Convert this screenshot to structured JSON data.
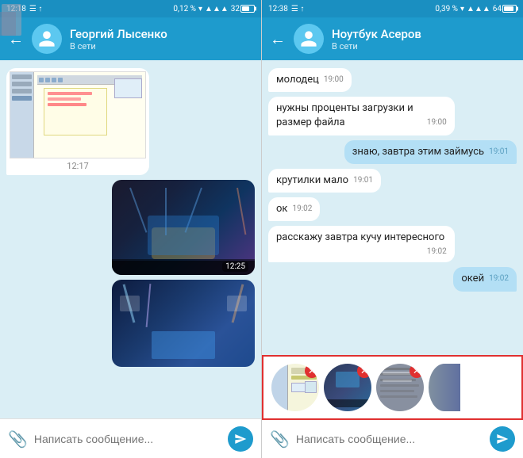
{
  "left": {
    "statusBar": {
      "time": "12:18",
      "icons": "☰ ↑",
      "percent": "0,12 %",
      "battery": "32",
      "signal": "▲▲▲"
    },
    "header": {
      "backLabel": "←",
      "name": "Георгий Лысенко",
      "status": "В сети"
    },
    "messages": [
      {
        "type": "screenshot",
        "time": "12:17",
        "direction": "incoming"
      },
      {
        "type": "concert1",
        "time": "12:25",
        "direction": "outgoing"
      },
      {
        "type": "concert2",
        "direction": "outgoing"
      }
    ],
    "input": {
      "placeholder": "Написать сообщение...",
      "attachIcon": "📎"
    }
  },
  "right": {
    "statusBar": {
      "time": "12:38",
      "percent": "0,39 %",
      "battery": "64"
    },
    "header": {
      "backLabel": "←",
      "name": "Ноутбук Асеров",
      "status": "В сети"
    },
    "messages": [
      {
        "type": "text",
        "text": "молодец",
        "time": "19:00",
        "direction": "incoming"
      },
      {
        "type": "text",
        "text": "нужны проценты загрузки и размер файла",
        "time": "19:00",
        "direction": "incoming"
      },
      {
        "type": "text",
        "text": "знаю, завтра этим займусь",
        "time": "19:01",
        "direction": "outgoing"
      },
      {
        "type": "text",
        "text": "крутилки мало",
        "time": "19:01",
        "direction": "incoming"
      },
      {
        "type": "text",
        "text": "ок",
        "time": "19:02",
        "direction": "incoming"
      },
      {
        "type": "text",
        "text": "расскажу завтра кучу интересного",
        "time": "19:02",
        "direction": "incoming"
      },
      {
        "type": "text",
        "text": "окей",
        "time": "19:02",
        "direction": "outgoing"
      }
    ],
    "attachmentPreviews": [
      {
        "id": 1,
        "label": "screenshot-thumb"
      },
      {
        "id": 2,
        "label": "concert-thumb"
      },
      {
        "id": 3,
        "label": "handwriting-thumb"
      },
      {
        "id": 4,
        "label": "building-partial"
      }
    ],
    "input": {
      "placeholder": "Написать сообщение...",
      "attachIcon": "📎"
    }
  }
}
